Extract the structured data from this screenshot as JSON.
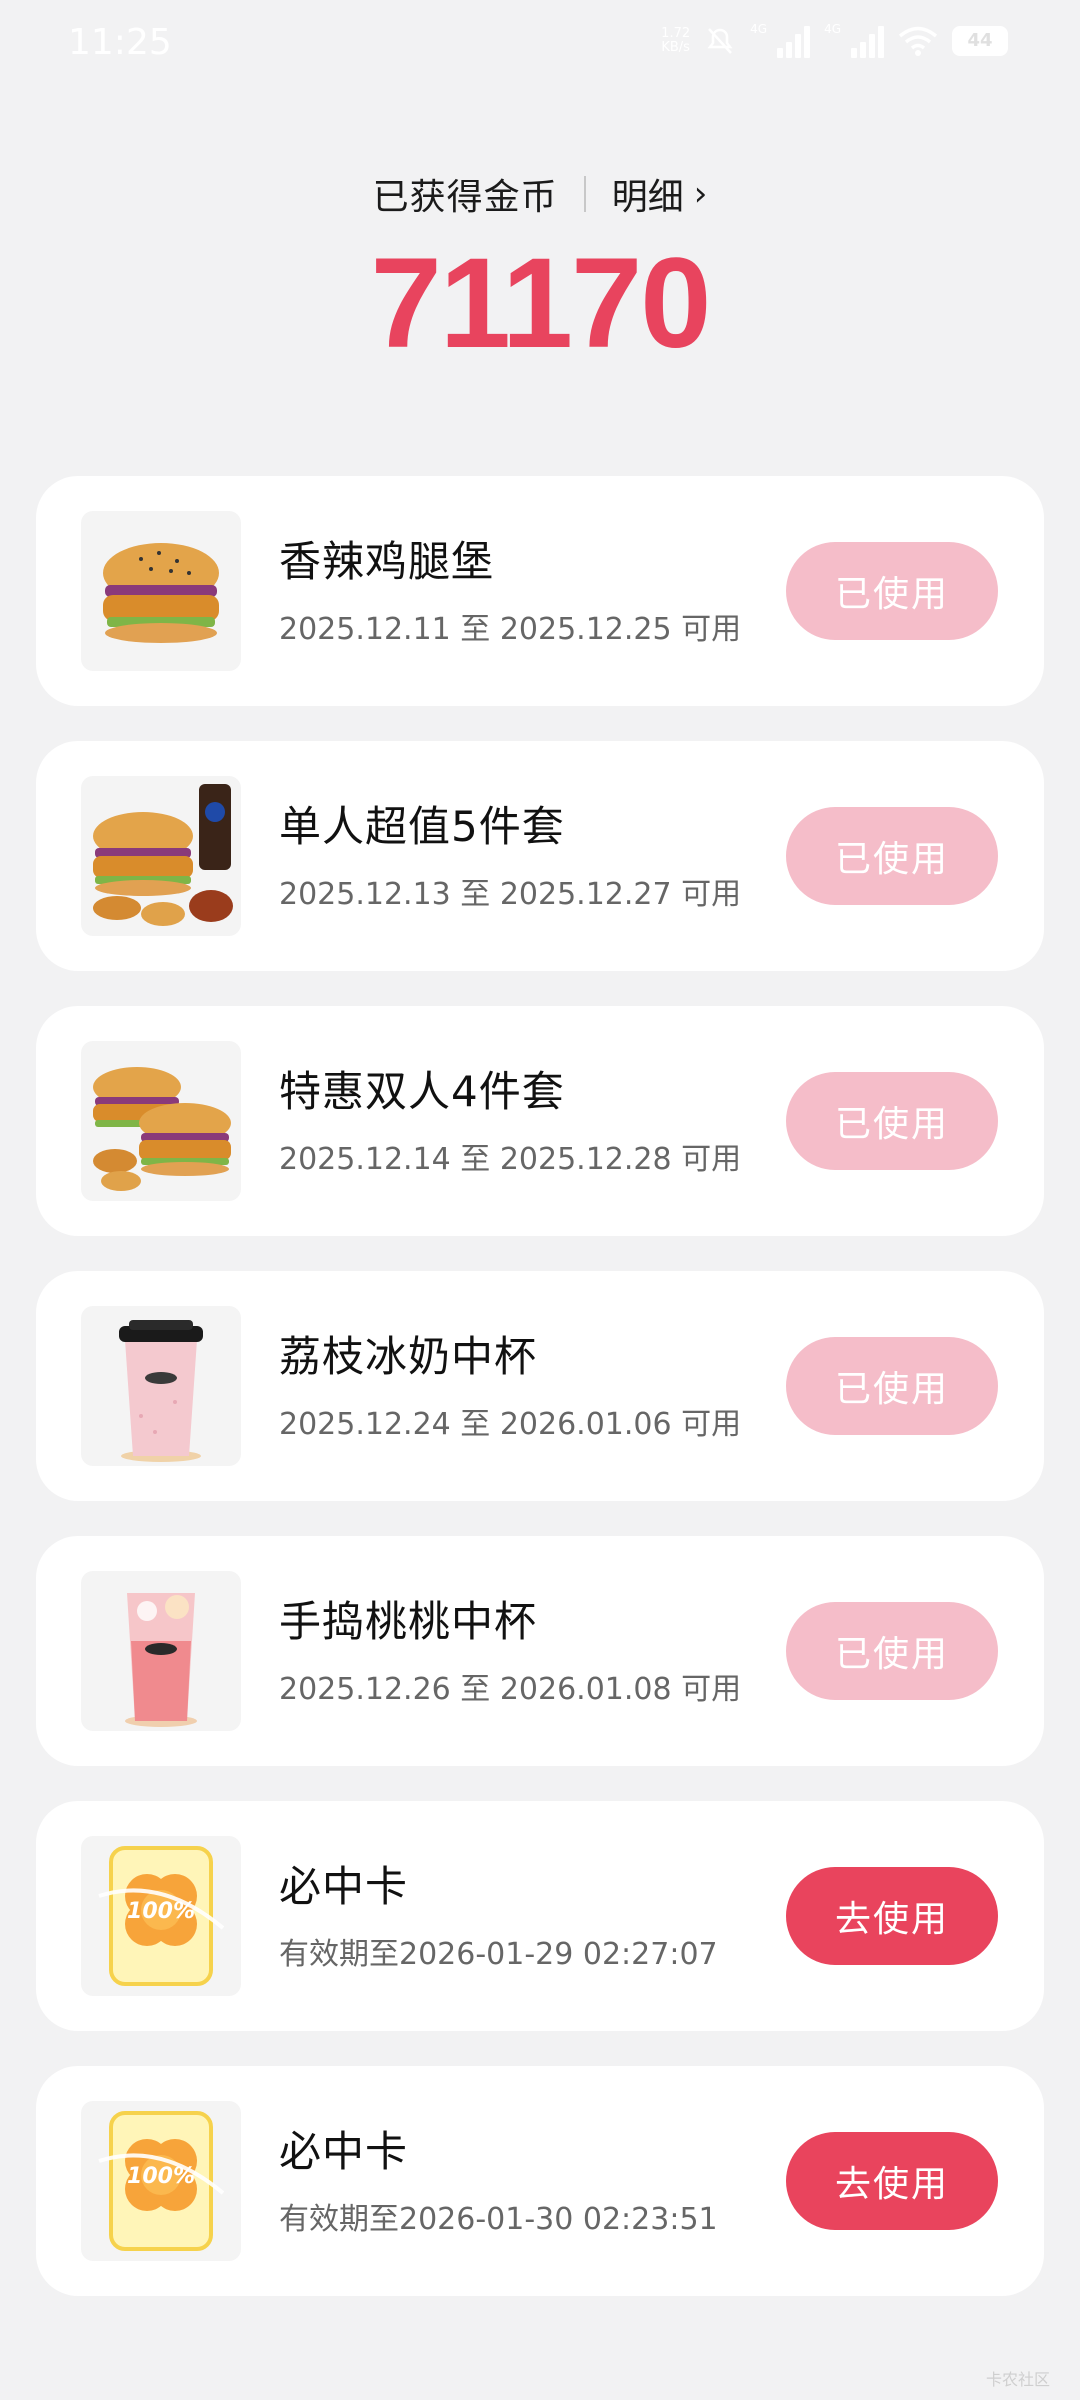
{
  "status_bar": {
    "time": "11:25",
    "net_speed_value": "1.72",
    "net_speed_unit": "KB/s",
    "sim1_label": "4G",
    "sim2_label": "4G",
    "battery": "44"
  },
  "header": {
    "coins_label": "已获得金币",
    "detail_label": "明细",
    "coins_value": "71170"
  },
  "coupons": [
    {
      "title": "香辣鸡腿堡",
      "date": "2025.12.11 至 2025.12.25 可用",
      "button": "已使用",
      "state": "used",
      "icon": "chicken-burger-icon"
    },
    {
      "title": "单人超值5件套",
      "date": "2025.12.13 至 2025.12.27 可用",
      "button": "已使用",
      "state": "used",
      "icon": "single-combo-icon"
    },
    {
      "title": "特惠双人4件套",
      "date": "2025.12.14 至 2025.12.28 可用",
      "button": "已使用",
      "state": "used",
      "icon": "double-combo-icon"
    },
    {
      "title": "荔枝冰奶中杯",
      "date": "2025.12.24 至 2026.01.06 可用",
      "button": "已使用",
      "state": "used",
      "icon": "lychee-milk-cup-icon"
    },
    {
      "title": "手捣桃桃中杯",
      "date": "2025.12.26 至 2026.01.08 可用",
      "button": "已使用",
      "state": "used",
      "icon": "peach-drink-cup-icon"
    },
    {
      "title": "必中卡",
      "date": "有效期至2026-01-29 02:27:07",
      "button": "去使用",
      "state": "active",
      "icon": "win-card-icon",
      "badge": "100%"
    },
    {
      "title": "必中卡",
      "date": "有效期至2026-01-30 02:23:51",
      "button": "去使用",
      "state": "active",
      "icon": "win-card-icon",
      "badge": "100%"
    }
  ],
  "colors": {
    "accent": "#e9445d",
    "used_button": "#f5bdc9",
    "background": "#f2f2f3"
  },
  "watermark": "卡农社区"
}
